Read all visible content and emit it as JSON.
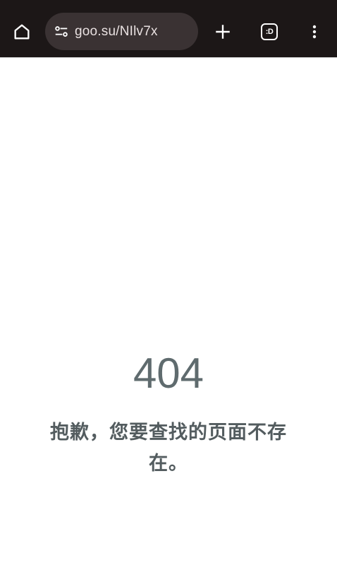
{
  "browser": {
    "url": "goo.su/NIlv7x",
    "tab_count": ":D"
  },
  "page": {
    "error_code": "404",
    "message": "抱歉，您要查找的页面不存在。"
  }
}
